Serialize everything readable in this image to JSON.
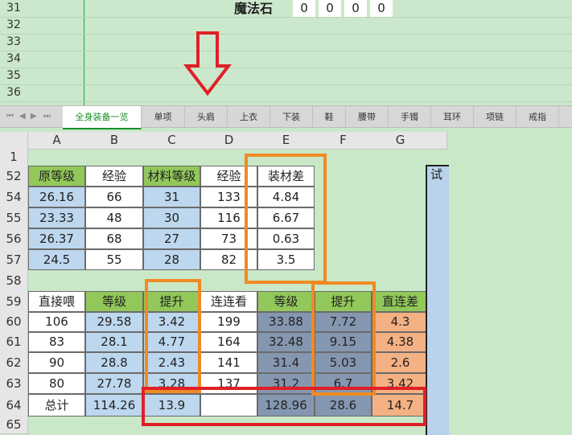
{
  "top_rows": [
    "31",
    "32",
    "33",
    "34",
    "35",
    "36"
  ],
  "mofa": {
    "label": "魔法石",
    "values": [
      "0",
      "0",
      "0",
      "0"
    ]
  },
  "tabs": [
    "全身装备一览",
    "单项",
    "头肩",
    "上衣",
    "下装",
    "鞋",
    "腰带",
    "手镯",
    "耳环",
    "项链",
    "戒指"
  ],
  "columns": [
    "A",
    "B",
    "C",
    "D",
    "E",
    "F",
    "G"
  ],
  "rows": [
    "1",
    "52",
    "54",
    "55",
    "56",
    "57",
    "58",
    "59",
    "60",
    "61",
    "62",
    "63",
    "64",
    "65"
  ],
  "table1": {
    "headers": [
      "原等级",
      "经验",
      "材料等级",
      "经验",
      "装材差"
    ],
    "rows": [
      [
        "26.16",
        "66",
        "31",
        "133",
        "4.84"
      ],
      [
        "23.33",
        "48",
        "30",
        "116",
        "6.67"
      ],
      [
        "26.37",
        "68",
        "27",
        "73",
        "0.63"
      ],
      [
        "24.5",
        "55",
        "28",
        "82",
        "3.5"
      ]
    ]
  },
  "table2": {
    "headers": [
      "直接喂",
      "等级",
      "提升",
      "连连看",
      "等级",
      "提升",
      "直连差"
    ],
    "rows": [
      [
        "106",
        "29.58",
        "3.42",
        "199",
        "33.88",
        "7.72",
        "4.3"
      ],
      [
        "83",
        "28.1",
        "4.77",
        "164",
        "32.48",
        "9.15",
        "4.38"
      ],
      [
        "90",
        "28.8",
        "2.43",
        "141",
        "31.4",
        "5.03",
        "2.6"
      ],
      [
        "80",
        "27.78",
        "3.28",
        "137",
        "31.2",
        "6.7",
        "3.42"
      ]
    ],
    "total": [
      "总计",
      "114.26",
      "13.9",
      "",
      "128.96",
      "28.6",
      "14.7"
    ]
  },
  "right_panel_char": "试"
}
